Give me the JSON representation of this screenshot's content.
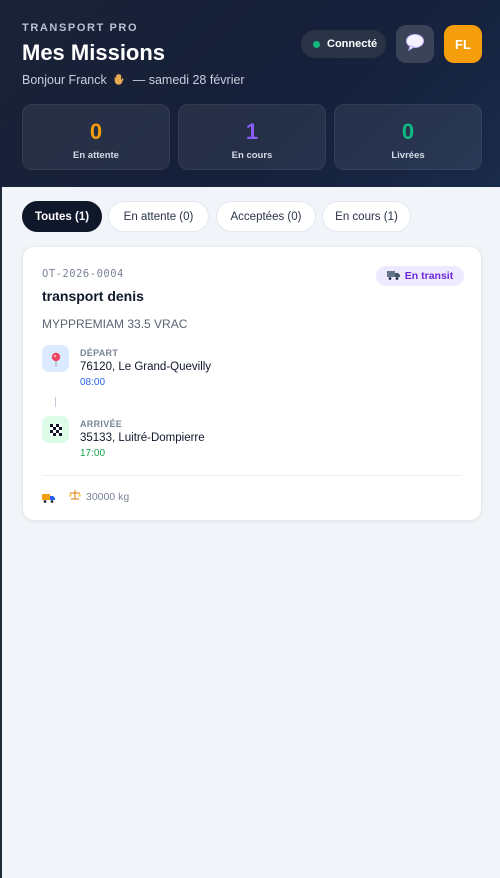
{
  "header": {
    "brand": "TRANSPORT PRO",
    "title": "Mes Missions",
    "greeting_prefix": "Bonjour Franck",
    "greeting_icon": "waving-hand-icon",
    "greeting_suffix": "— samedi 28 février",
    "status": {
      "label": "Connecté",
      "color": "#10b981"
    },
    "chat_icon": "speech-bubble-icon",
    "avatar_initials": "FL"
  },
  "stats": [
    {
      "value": "0",
      "label": "En attente",
      "color": "#f59e0b"
    },
    {
      "value": "1",
      "label": "En cours",
      "color": "#8b5cf6"
    },
    {
      "value": "0",
      "label": "Livrées",
      "color": "#10b981"
    }
  ],
  "tabs": [
    {
      "label": "Toutes (1)",
      "active": true
    },
    {
      "label": "En attente (0)",
      "active": false
    },
    {
      "label": "Acceptées (0)",
      "active": false
    },
    {
      "label": "En cours (1)",
      "active": false
    }
  ],
  "mission": {
    "reference": "OT-2026-0004",
    "title": "transport denis",
    "status_badge": "En transit",
    "product": "MYPPREMIAM 33.5 VRAC",
    "departure": {
      "label": "DÉPART",
      "address": "76120, Le Grand-Quevilly",
      "time": "08:00",
      "color": "#2563eb"
    },
    "arrival": {
      "label": "ARRIVÉE",
      "address": "35133, Luitré-Dompierre",
      "time": "17:00",
      "color": "#16a34a"
    },
    "weight": "30000 kg"
  }
}
